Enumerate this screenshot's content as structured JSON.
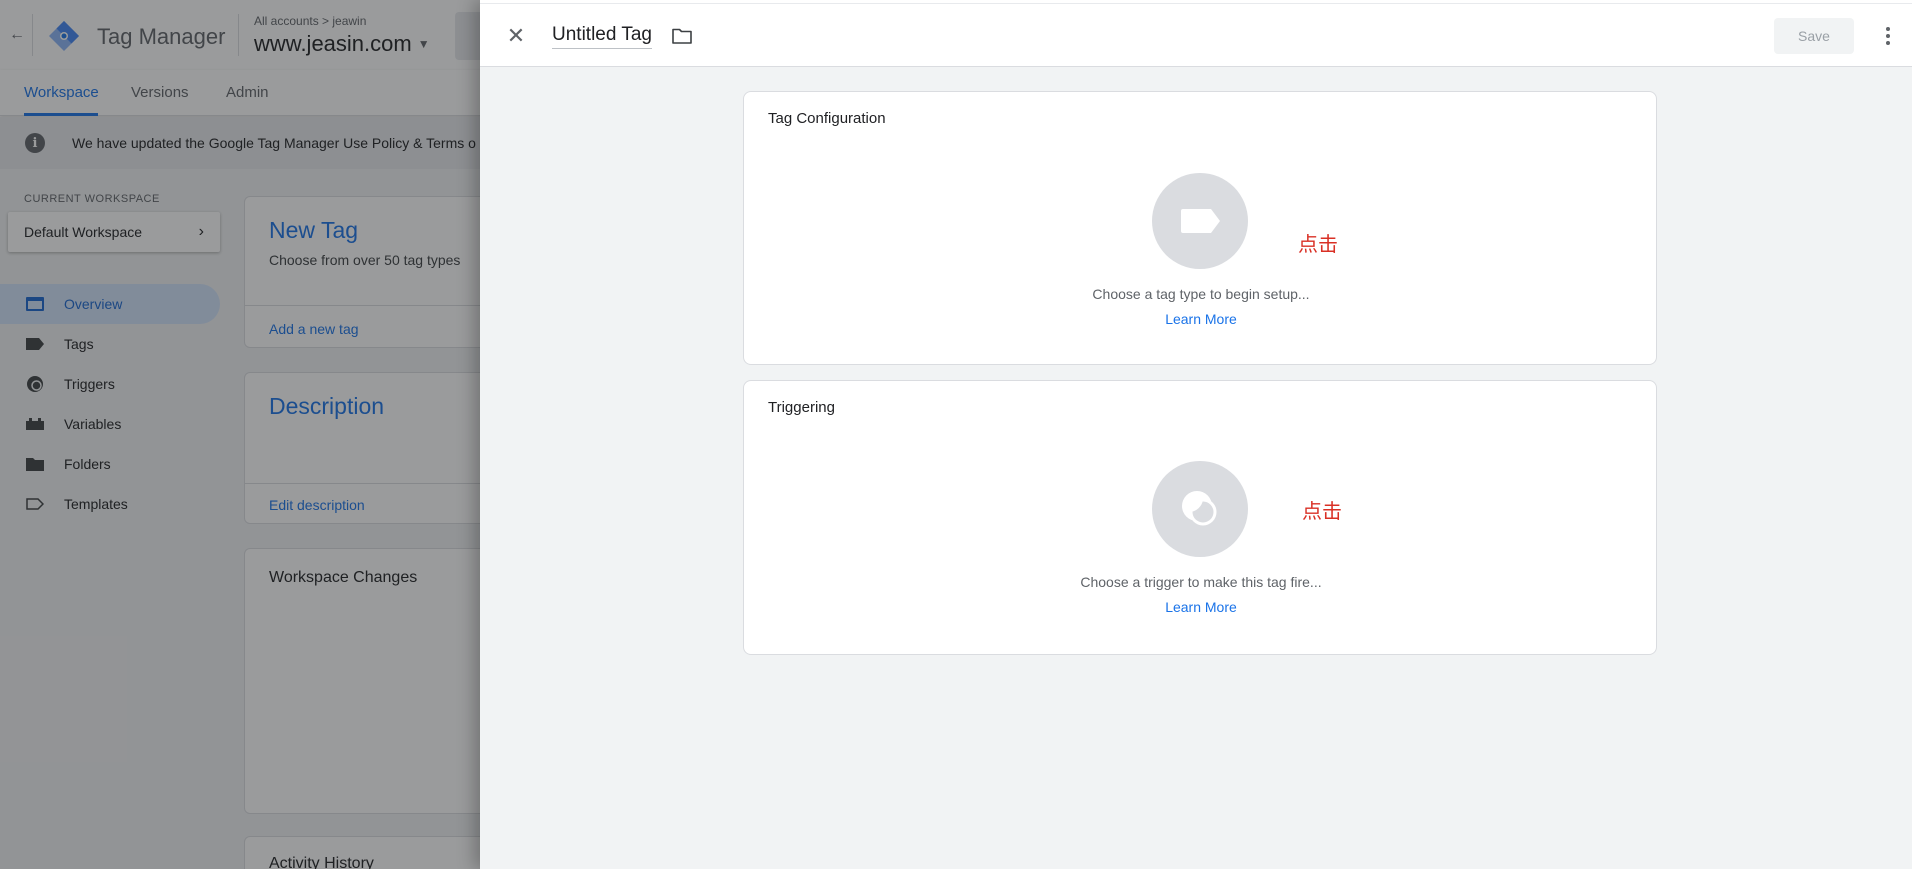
{
  "app": {
    "title": "Tag Manager",
    "breadcrumb": "All accounts > jeawin",
    "container_name": "www.jeasin.com",
    "back_icon": "arrow-left-icon",
    "logo_icon": "gtm-diamond-icon"
  },
  "tabs": [
    {
      "label": "Workspace",
      "active": true
    },
    {
      "label": "Versions",
      "active": false
    },
    {
      "label": "Admin",
      "active": false
    }
  ],
  "notice": {
    "text": "We have updated the Google Tag Manager Use Policy & Terms o"
  },
  "sidebar": {
    "workspace_label": "CURRENT WORKSPACE",
    "workspace_name": "Default Workspace",
    "items": [
      {
        "label": "Overview",
        "icon": "overview-icon",
        "active": true
      },
      {
        "label": "Tags",
        "icon": "tag-icon",
        "active": false
      },
      {
        "label": "Triggers",
        "icon": "trigger-icon",
        "active": false
      },
      {
        "label": "Variables",
        "icon": "variables-icon",
        "active": false
      },
      {
        "label": "Folders",
        "icon": "folder-icon",
        "active": false
      },
      {
        "label": "Templates",
        "icon": "template-icon",
        "active": false
      }
    ]
  },
  "bg_cards": {
    "new_tag": {
      "title": "New Tag",
      "subtitle": "Choose from over 50 tag types",
      "link": "Add a new tag"
    },
    "description": {
      "title": "Description",
      "link": "Edit description"
    },
    "workspace_changes": {
      "title": "Workspace Changes"
    },
    "activity_history": {
      "title": "Activity History"
    }
  },
  "sheet": {
    "tag_name": "Untitled Tag",
    "save_label": "Save",
    "tag_configuration": {
      "title": "Tag Configuration",
      "hint": "Choose a tag type to begin setup...",
      "learn_more": "Learn More",
      "annotation": "点击"
    },
    "triggering": {
      "title": "Triggering",
      "hint": "Choose a trigger to make this tag fire...",
      "learn_more": "Learn More",
      "annotation": "点击"
    }
  },
  "colors": {
    "accent": "#1a73e8",
    "annotation": "#d93025",
    "panel_bg": "#f1f3f4"
  }
}
